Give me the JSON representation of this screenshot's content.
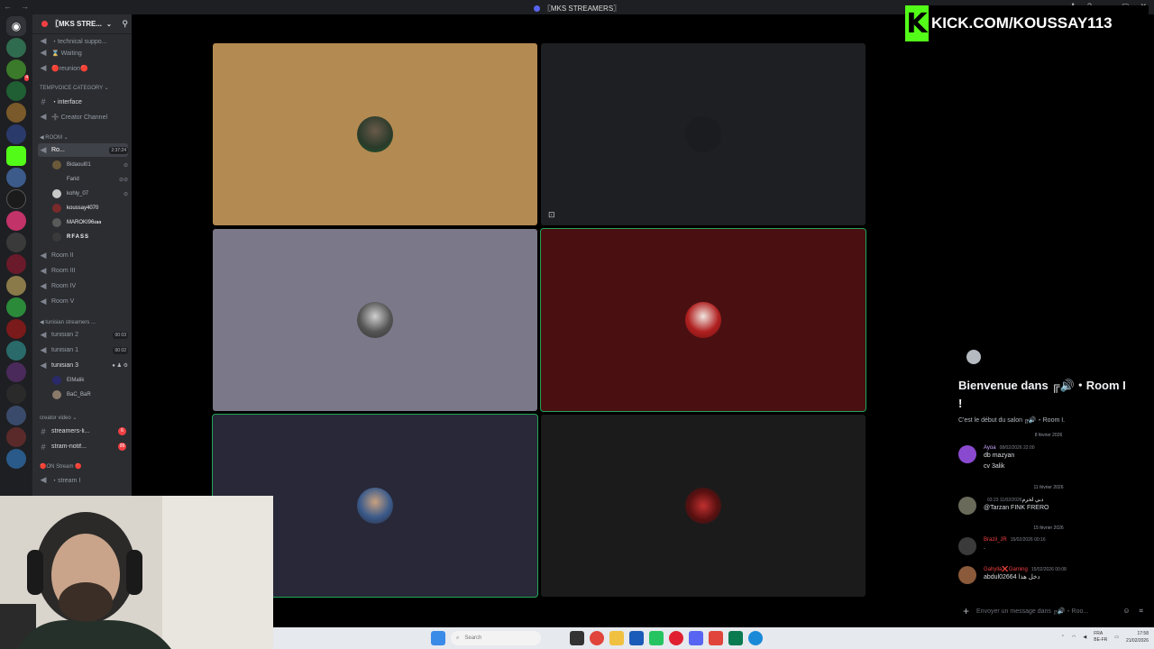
{
  "window": {
    "title": "〖MKS STREAMERS〗"
  },
  "kick": {
    "banner": "KICK.COM/KOUSSAY113"
  },
  "guild": {
    "name": "〖MKS STRE..."
  },
  "channels": {
    "top": [
      {
        "label": "・technical suppo..."
      },
      {
        "label": "⌛ Waiting"
      },
      {
        "label": "🔴reunion🔴"
      }
    ],
    "tempvoice_category": "TEMPVOICE CATEGORY",
    "tempvoice": [
      {
        "label": "・interface"
      },
      {
        "label": "➕ Creator Channel"
      }
    ],
    "room_category": "Room",
    "active_room": {
      "label": "Ro...",
      "time": "2:37:24"
    },
    "room_users": [
      "Bidaoul01",
      "Farid",
      "kohly_07",
      "koussay4070",
      "MAROKI96𝖈𝖆𝖆",
      "RFASS"
    ],
    "rooms": [
      {
        "label": "Room II"
      },
      {
        "label": "Room III"
      },
      {
        "label": "Room IV"
      },
      {
        "label": "Room V"
      }
    ],
    "tunisian_category": "tunisian streamers ...",
    "tunisian": [
      {
        "label": "tunisian 2",
        "count": "00 03"
      },
      {
        "label": "tunisian 1",
        "count": "00 02"
      },
      {
        "label": "tunisian 3",
        "count": ""
      }
    ],
    "tunisian_users": [
      "ElMalik",
      "BaC_BaR"
    ],
    "creator_category": "creator video",
    "creator": [
      {
        "label": "streamers-li...",
        "badge": "6"
      },
      {
        "label": "stram-notif...",
        "badge": "99"
      }
    ],
    "onstream_category": "🔴ON Stream 🔴",
    "onstream": [
      {
        "label": "・stream I"
      }
    ]
  },
  "room_panel": {
    "welcome": "Bienvenue dans ╔🔊・Room I !",
    "subtitle": "C'est le début du salon ╔🔊・Room I.",
    "dates": [
      "8 février 2026",
      "11 février 2026",
      "15 février 2026"
    ],
    "messages": [
      {
        "author": "Ayoa",
        "time": "08/02/2026 22:00",
        "lines": [
          "db mazyan",
          "cv 3alik"
        ],
        "color": "#c9a7ff"
      },
      {
        "author": "دبي لحرم",
        "time": "11/02/2026 03:23",
        "lines": [
          "@Tarzan FINK FRERO"
        ],
        "color": "#f2f3f5"
      },
      {
        "author": "Brazil_JR",
        "time": "15/02/2026 00:16",
        "lines": [
          "."
        ],
        "color": "#f23f43"
      },
      {
        "author": "Gahylla❌Gaming",
        "time": "15/02/2026 00:08",
        "lines": [
          "abdul02664 دخل هذا"
        ],
        "color": "#f23f43"
      }
    ],
    "composer_placeholder": "Envoyer un message dans ╔🔊・Roo..."
  },
  "taskbar": {
    "search": "Search",
    "time": "17:58",
    "date": "21/02/2026",
    "lang": "FRA\nBE-FR"
  },
  "colors": {
    "kick_green": "#53fc18",
    "discord_bg": "#2b2d31",
    "speaking": "#23a559"
  }
}
